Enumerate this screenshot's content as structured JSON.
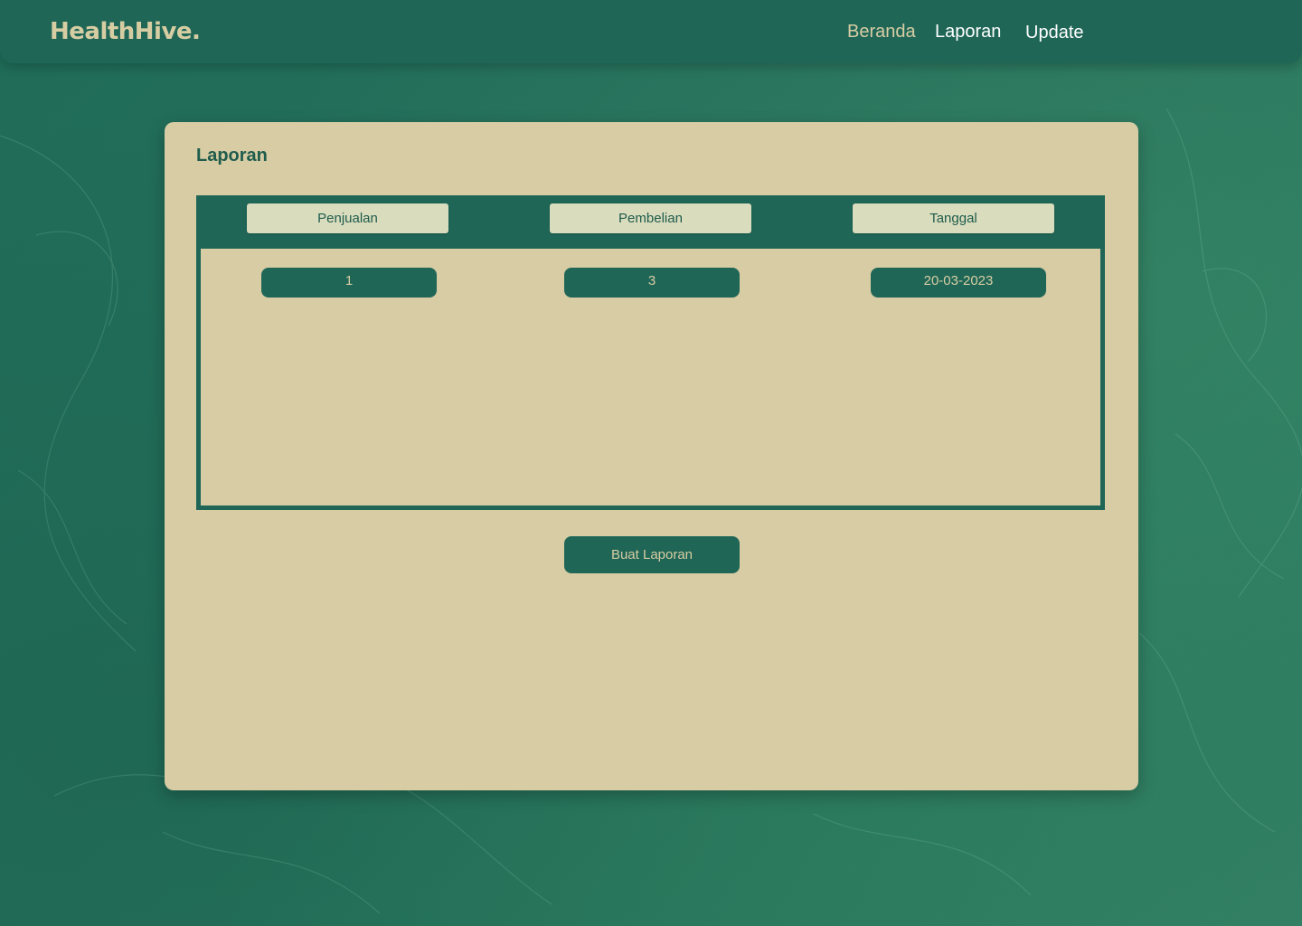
{
  "brand": {
    "name": "HealthHive."
  },
  "nav": {
    "items": [
      {
        "label": "Beranda"
      },
      {
        "label": "Laporan"
      },
      {
        "label": "Update"
      }
    ]
  },
  "report": {
    "title": "Laporan",
    "columns": [
      "Penjualan",
      "Pembelian",
      "Tanggal"
    ],
    "rows": [
      [
        "1",
        "3",
        "20-03-2023"
      ]
    ],
    "action_label": "Buat Laporan"
  },
  "colors": {
    "background": "#256f5b",
    "nav_bg": "#1f6657",
    "accent_cream": "#d7cda3",
    "card_bg": "#d7cca4",
    "header_cell_bg": "#d9dcbd",
    "primary_text": "#1f5c4c"
  }
}
